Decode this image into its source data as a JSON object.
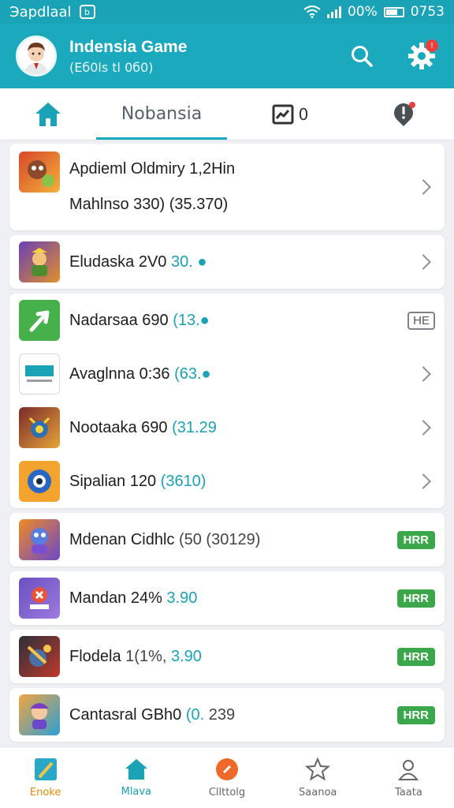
{
  "status_bar": {
    "carrier": "Эapdlaal",
    "app_glyph": "b",
    "battery": "00%",
    "time": "0753"
  },
  "header": {
    "title": "Indensia Game",
    "subtitle": "(Eб0ls tl 0б0)"
  },
  "tabs": {
    "main_label": "Nobansia",
    "message_count": "0"
  },
  "featured": {
    "line1_a": "Apdieml Oldmiry ",
    "line1_b": "1,2",
    "line1_c": "Hin",
    "line2_a": "Mahlnso 330) ",
    "line2_b": "(35.370)"
  },
  "items": [
    {
      "a": "Eludaska 2V0 ",
      "b": "30. ",
      "c": "",
      "action": "chevron"
    },
    {
      "a": "Nadarsaa 690 ",
      "b": "(13.",
      "c": "",
      "action": "outline",
      "tag": "HE"
    },
    {
      "a": "Avaglnna 0:36 ",
      "b": "(63.",
      "c": "",
      "action": "chevron"
    },
    {
      "a": "Nootaaka 690 ",
      "b": "(31.29",
      "c": "",
      "action": "chevron"
    },
    {
      "a": "Sipalian 120 ",
      "b": "(3610)",
      "c": "",
      "action": "chevron"
    },
    {
      "a": "Mdenan Cidhlc ",
      "b": "",
      "c": "(50 (30129)",
      "action": "tag",
      "tag": "HRR"
    },
    {
      "a": "Mandan 24% ",
      "b": "3.90",
      "c": "",
      "action": "tag",
      "tag": "HRR"
    },
    {
      "a": "Flodela ",
      "b": "3.90",
      "c": "1(1%, ",
      "action": "tag",
      "tag": "HRR"
    },
    {
      "a": "Cantasral GBh0 ",
      "b": "(0. ",
      "c": "239",
      "action": "tag",
      "tag": "HRR"
    }
  ],
  "bottom_nav": [
    {
      "label": "Enoke"
    },
    {
      "label": "Mlava"
    },
    {
      "label": "Cllttolg"
    },
    {
      "label": "Saanoa"
    },
    {
      "label": "Taata"
    }
  ],
  "colors": {
    "primary": "#1aa9bd",
    "accent_text": "#1aa3b6",
    "green_tag": "#3aa84a",
    "badge": "#e8413c"
  }
}
